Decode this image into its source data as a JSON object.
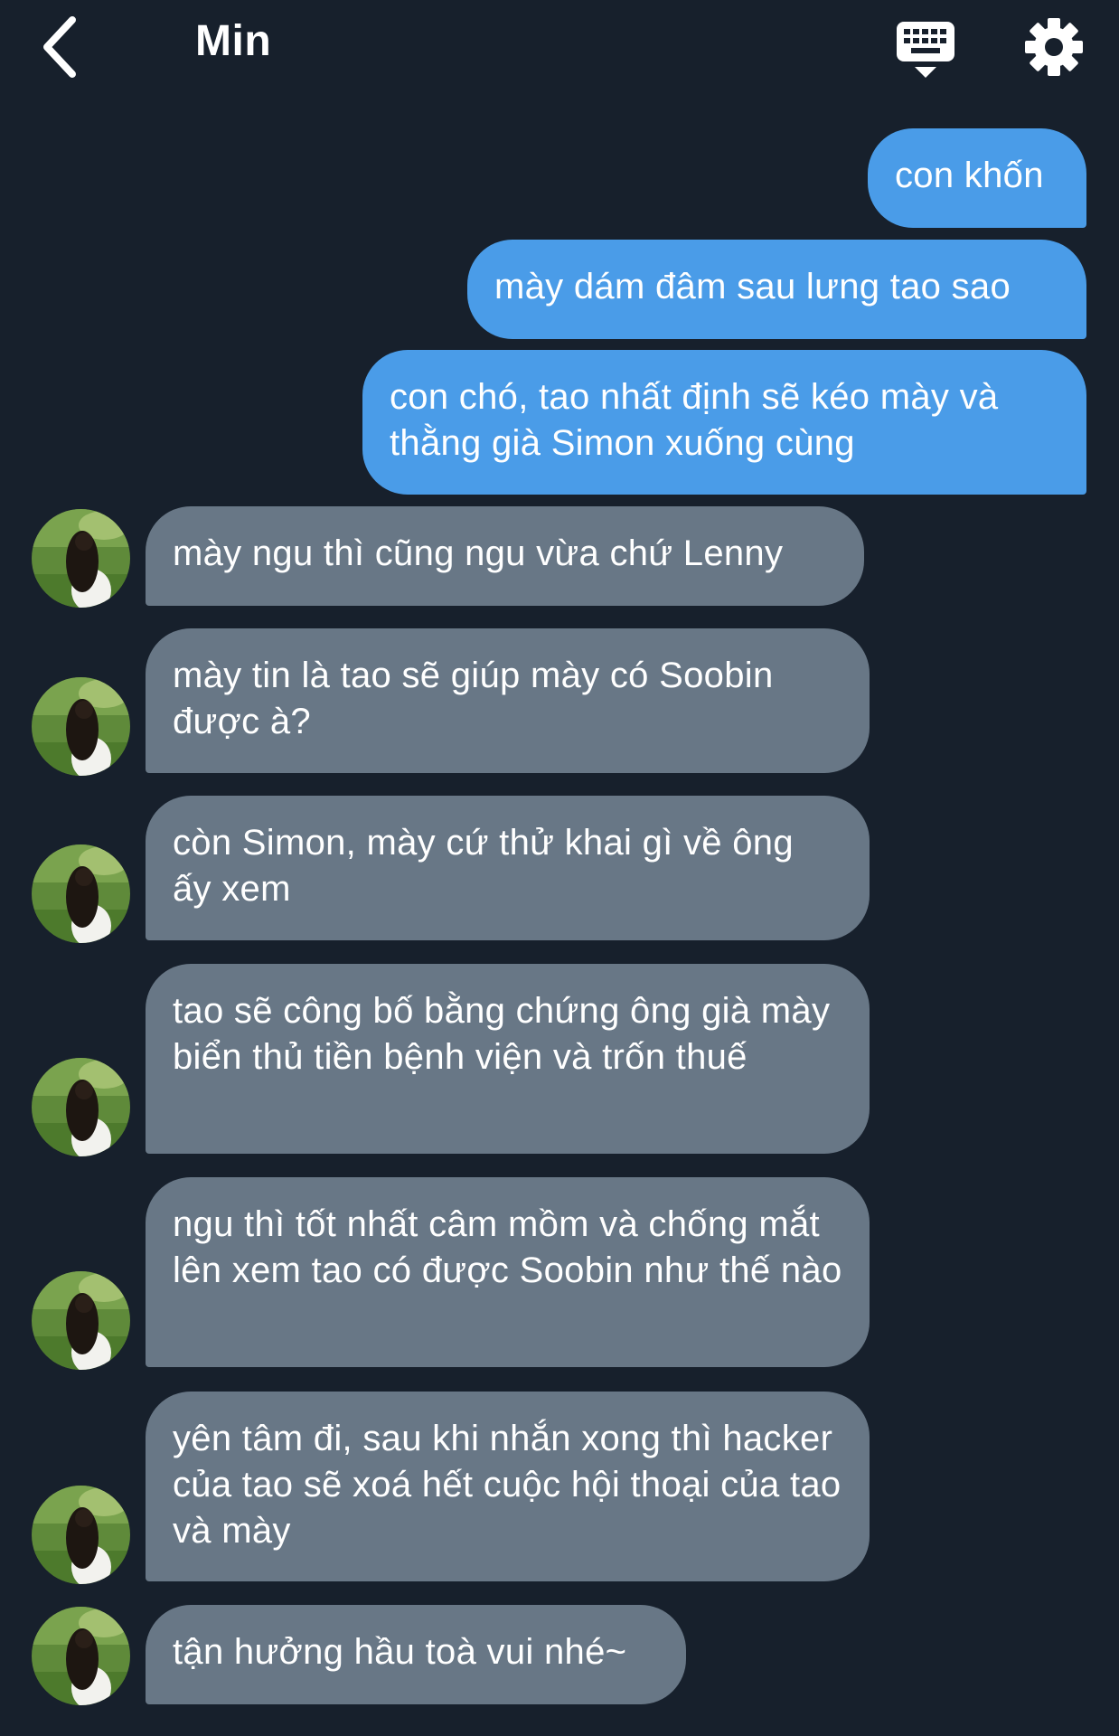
{
  "header": {
    "title": "Min",
    "back_icon": "chevron-left-icon",
    "keyboard_icon": "keyboard-icon",
    "settings_icon": "gear-icon"
  },
  "colors": {
    "background": "#17202c",
    "outgoing_bubble": "#4a9ce8",
    "incoming_bubble": "#687786",
    "text": "#ffffff"
  },
  "messages": [
    {
      "from": "me",
      "text": "con khốn"
    },
    {
      "from": "me",
      "text": "mày dám đâm sau lưng tao sao"
    },
    {
      "from": "me",
      "text": "con chó, tao nhất định sẽ kéo mày và thằng già Simon xuống cùng"
    },
    {
      "from": "Min",
      "text": "mày ngu thì cũng ngu vừa chứ Lenny"
    },
    {
      "from": "Min",
      "text": "mày tin là tao sẽ giúp mày có Soobin được à?"
    },
    {
      "from": "Min",
      "text": "còn Simon, mày cứ thử khai gì về ông ấy xem"
    },
    {
      "from": "Min",
      "text": "tao sẽ công bố bằng chứng ông già mày biển thủ tiền bệnh viện và trốn thuế"
    },
    {
      "from": "Min",
      "text": "ngu thì tốt nhất câm mồm và chống mắt lên xem tao có được Soobin như thế nào"
    },
    {
      "from": "Min",
      "text": "yên tâm đi, sau khi nhắn xong thì hacker của tao sẽ xoá hết cuộc hội thoại của tao và mày"
    },
    {
      "from": "Min",
      "text": "tận hưởng hầu toà vui nhé~"
    }
  ]
}
